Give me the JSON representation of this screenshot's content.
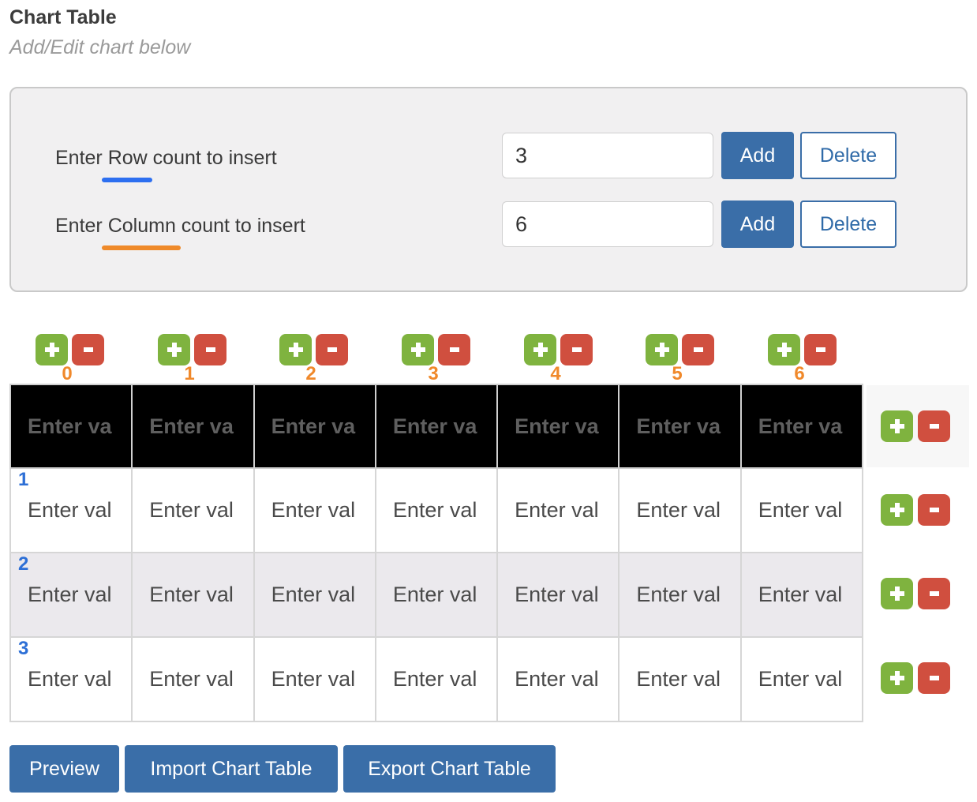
{
  "header": {
    "title": "Chart Table",
    "subtitle": "Add/Edit chart below"
  },
  "controls": {
    "row": {
      "label_before": "Enter ",
      "label_highlight": "Row",
      "label_after": " count to insert",
      "value": "3",
      "add_label": "Add",
      "delete_label": "Delete",
      "highlight_color": "#2d6ff0"
    },
    "column": {
      "label_before": "Enter ",
      "label_highlight": "Column",
      "label_after": " count to insert",
      "value": "6",
      "add_label": "Add",
      "delete_label": "Delete",
      "highlight_color": "#ef8a2a"
    }
  },
  "table": {
    "column_indices": [
      "0",
      "1",
      "2",
      "3",
      "4",
      "5",
      "6"
    ],
    "header_cells": [
      "Enter va",
      "Enter va",
      "Enter va",
      "Enter va",
      "Enter va",
      "Enter va",
      "Enter va"
    ],
    "rows": [
      {
        "index": "1",
        "cells": [
          "Enter val",
          "Enter val",
          "Enter val",
          "Enter val",
          "Enter val",
          "Enter val",
          "Enter val"
        ]
      },
      {
        "index": "2",
        "cells": [
          "Enter val",
          "Enter val",
          "Enter val",
          "Enter val",
          "Enter val",
          "Enter val",
          "Enter val"
        ]
      },
      {
        "index": "3",
        "cells": [
          "Enter val",
          "Enter val",
          "Enter val",
          "Enter val",
          "Enter val",
          "Enter val",
          "Enter val"
        ]
      }
    ],
    "icons": {
      "add": "plus-icon",
      "remove": "minus-icon"
    }
  },
  "actions": {
    "preview_label": "Preview",
    "import_label": "Import Chart Table",
    "export_label": "Export Chart Table"
  },
  "colors": {
    "primary": "#3a6ea8",
    "add_green": "#7fb33f",
    "remove_red": "#d04f3f",
    "column_index": "#f0892b",
    "row_index": "#2d6fd6"
  }
}
